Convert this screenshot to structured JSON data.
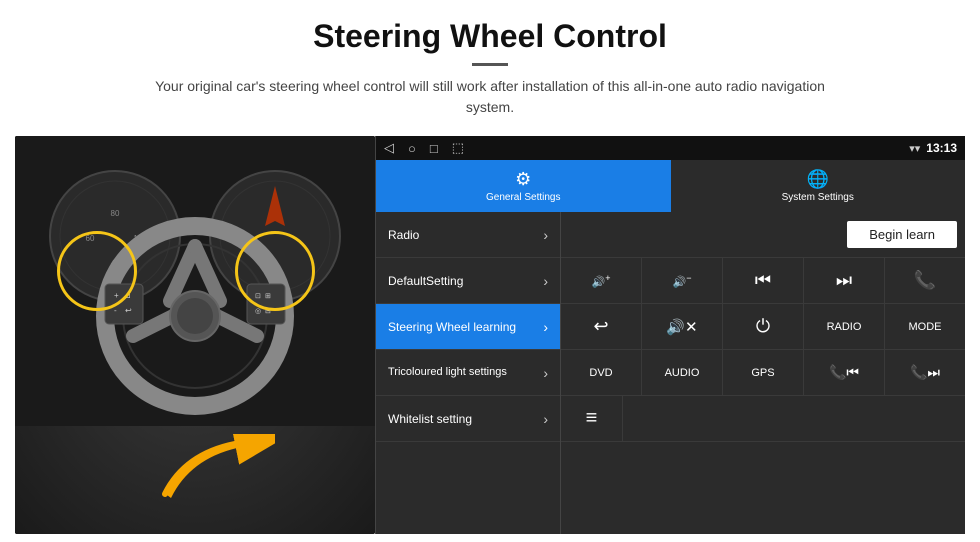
{
  "header": {
    "title": "Steering Wheel Control",
    "subtitle": "Your original car's steering wheel control will still work after installation of this all-in-one auto radio navigation system."
  },
  "android_ui": {
    "status_bar": {
      "back_icon": "◁",
      "home_icon": "○",
      "recents_icon": "□",
      "screenshot_icon": "⬚",
      "signal_icon": "▾▾",
      "time": "13:13"
    },
    "tabs": [
      {
        "label": "General Settings",
        "active": true
      },
      {
        "label": "System Settings",
        "active": false
      }
    ],
    "menu_items": [
      {
        "label": "Radio",
        "active": false
      },
      {
        "label": "DefaultSetting",
        "active": false
      },
      {
        "label": "Steering Wheel learning",
        "active": true
      },
      {
        "label": "Tricoloured light settings",
        "active": false
      },
      {
        "label": "Whitelist setting",
        "active": false
      }
    ],
    "begin_learn_label": "Begin learn",
    "control_rows": [
      [
        {
          "type": "icon",
          "icon": "🔊+",
          "label": "vol_up"
        },
        {
          "type": "icon",
          "icon": "🔊-",
          "label": "vol_down"
        },
        {
          "type": "icon",
          "icon": "⏮",
          "label": "prev_track"
        },
        {
          "type": "icon",
          "icon": "⏭",
          "label": "next_track"
        },
        {
          "type": "icon",
          "icon": "📞",
          "label": "phone"
        }
      ],
      [
        {
          "type": "icon",
          "icon": "↩",
          "label": "back"
        },
        {
          "type": "icon",
          "icon": "🔊✕",
          "label": "mute"
        },
        {
          "type": "icon",
          "icon": "⏻",
          "label": "power"
        },
        {
          "type": "text",
          "text": "RADIO",
          "label": "radio_btn"
        },
        {
          "type": "text",
          "text": "MODE",
          "label": "mode_btn"
        }
      ],
      [
        {
          "type": "text",
          "text": "DVD",
          "label": "dvd_btn"
        },
        {
          "type": "text",
          "text": "AUDIO",
          "label": "audio_btn"
        },
        {
          "type": "text",
          "text": "GPS",
          "label": "gps_btn"
        },
        {
          "type": "icon",
          "icon": "📞⏮",
          "label": "phone_prev"
        },
        {
          "type": "icon",
          "icon": "📞⏭",
          "label": "phone_next"
        }
      ]
    ],
    "bottom_icon": "≡"
  }
}
